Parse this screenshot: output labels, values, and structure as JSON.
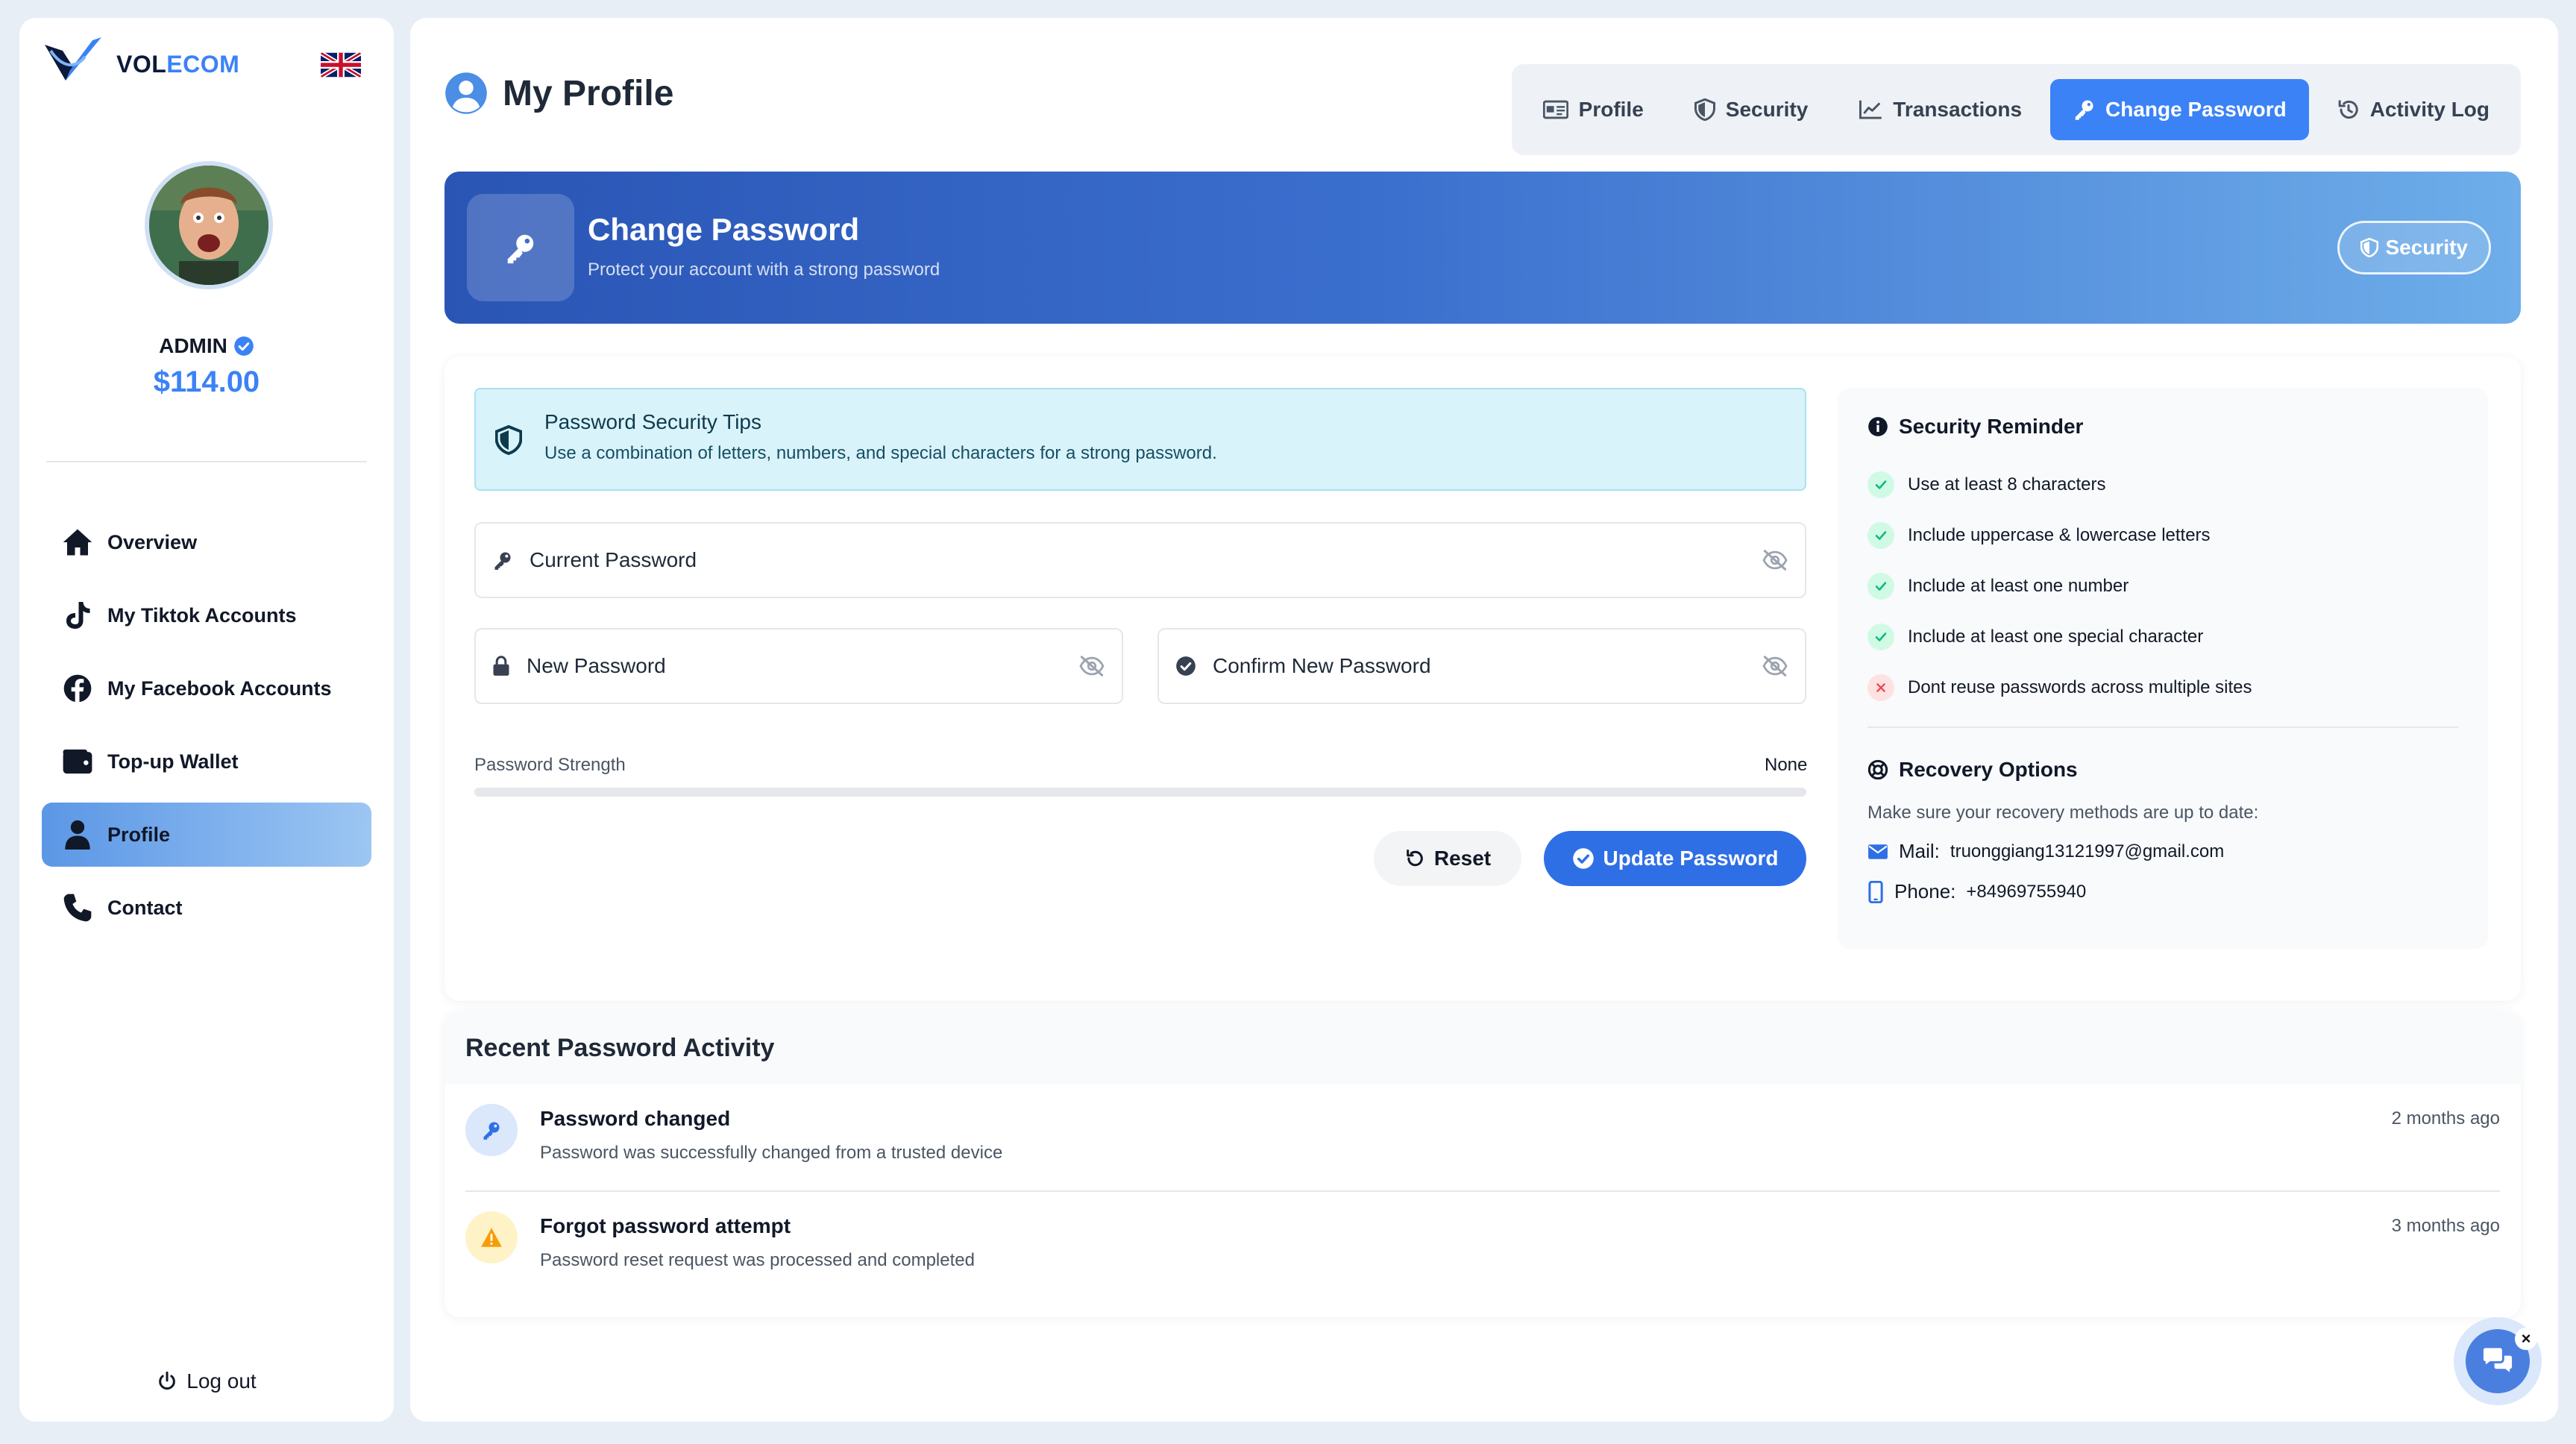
{
  "brand": {
    "name_part1": "VOL",
    "name_part2": "ECOM"
  },
  "user": {
    "name": "ADMIN",
    "balance": "$114.00"
  },
  "sidebar": {
    "items": [
      {
        "label": "Overview",
        "icon": "home-icon"
      },
      {
        "label": "My Tiktok Accounts",
        "icon": "tiktok-icon"
      },
      {
        "label": "My Facebook Accounts",
        "icon": "facebook-icon"
      },
      {
        "label": "Top-up Wallet",
        "icon": "wallet-icon"
      },
      {
        "label": "Profile",
        "icon": "user-icon",
        "active": true
      },
      {
        "label": "Contact",
        "icon": "phone-icon"
      }
    ],
    "logout": "Log out"
  },
  "header": {
    "title": "My Profile",
    "tabs": [
      {
        "label": "Profile",
        "icon": "id-card-icon"
      },
      {
        "label": "Security",
        "icon": "shield-icon"
      },
      {
        "label": "Transactions",
        "icon": "chart-line-icon"
      },
      {
        "label": "Change Password",
        "icon": "key-icon",
        "active": true
      },
      {
        "label": "Activity Log",
        "icon": "history-icon"
      }
    ]
  },
  "hero": {
    "title": "Change Password",
    "subtitle": "Protect your account with a strong password",
    "badge": "Security"
  },
  "tips": {
    "title": "Password Security Tips",
    "text": "Use a combination of letters, numbers, and special characters for a strong password."
  },
  "form": {
    "current_password": "Current Password",
    "new_password": "New Password",
    "confirm_password": "Confirm New Password",
    "strength_label": "Password Strength",
    "strength_value": "None",
    "strength_fraction": 0,
    "reset_label": "Reset",
    "update_label": "Update Password"
  },
  "reminder": {
    "title": "Security Reminder",
    "items": [
      {
        "text": "Use at least 8 characters",
        "ok": true
      },
      {
        "text": "Include uppercase & lowercase letters",
        "ok": true
      },
      {
        "text": "Include at least one number",
        "ok": true
      },
      {
        "text": "Include at least one special character",
        "ok": true
      },
      {
        "text": "Dont reuse passwords across multiple sites",
        "ok": false
      }
    ]
  },
  "recovery": {
    "title": "Recovery Options",
    "desc": "Make sure your recovery methods are up to date:",
    "mail_label": "Mail:",
    "mail_value": "truonggiang13121997@gmail.com",
    "phone_label": "Phone:",
    "phone_value": "+84969755940"
  },
  "activity": {
    "title": "Recent Password Activity",
    "items": [
      {
        "title": "Password changed",
        "desc": "Password was successfully changed from a trusted device",
        "time": "2 months ago",
        "icon": "key-icon"
      },
      {
        "title": "Forgot password attempt",
        "desc": "Password reset request was processed and completed",
        "time": "3 months ago",
        "icon": "warning-icon"
      }
    ]
  },
  "chat": {
    "close": "×"
  },
  "colors": {
    "accent": "#3b82f6",
    "success": "#10b981",
    "danger": "#ef4444",
    "warning": "#f59e0b"
  }
}
